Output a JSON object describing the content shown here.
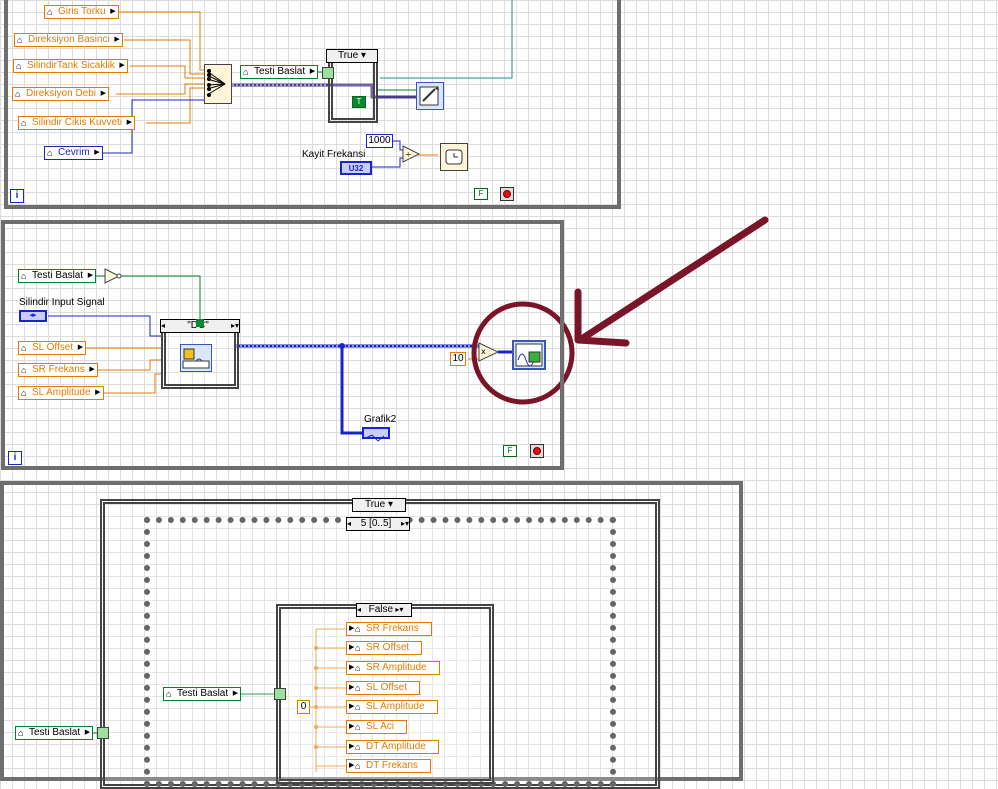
{
  "loop1": {
    "controls": [
      {
        "label": "Giris Torku"
      },
      {
        "label": "Direksiyon   Basinci"
      },
      {
        "label": "SilindirTank   Sicaklik"
      },
      {
        "label": "Direksiyon      Debi"
      },
      {
        "label": "     Silindir Cikis Kuvveti"
      },
      {
        "label": "Cevrim"
      }
    ],
    "testi_baslat": "Testi Baslat",
    "case_selector": "True",
    "true_const": "T",
    "const_1000": "1000",
    "kayit_frekansi_label": "Kayit Frekansi",
    "u32_label": "U32",
    "false_const": "F"
  },
  "loop2": {
    "testi_baslat": "Testi Baslat",
    "signal_label": "Silindir Input Signal",
    "case_selector": "\"DC\"",
    "controls": [
      {
        "label": "SL Offset"
      },
      {
        "label": "SR Frekans"
      },
      {
        "label": "SL Amplitude"
      }
    ],
    "const_10": "10",
    "grafik_label": "Grafik2",
    "false_const": "F"
  },
  "loop3": {
    "outer_case_selector": "True",
    "sequence_selector": "5 [0..5]",
    "inner_case_selector": "False",
    "testi_baslat_inner": "Testi Baslat",
    "testi_baslat_outer": "Testi Baslat",
    "const_0": "0",
    "locals": [
      {
        "label": "SR Frekans"
      },
      {
        "label": "SR Offset"
      },
      {
        "label": "SR Amplitude"
      },
      {
        "label": "SL Offset"
      },
      {
        "label": "SL Amplitude"
      },
      {
        "label": "SL Aci"
      },
      {
        "label": "DT Amplitude"
      },
      {
        "label": "DT Frekans"
      }
    ]
  },
  "colors": {
    "annotation": "#7a1428",
    "orange_wire": "#e47b00",
    "blue_wire": "#1a25c6",
    "green_wire": "#00822b",
    "teal_wire": "#1a8c8c"
  },
  "icons": {
    "annotation": "highlight-circle-and-arrow",
    "vi_write": "write-file-icon",
    "vi_wait": "wait-ms-icon",
    "vi_generate": "simulate-signal-icon",
    "vi_write_output": "daq-write-icon"
  }
}
